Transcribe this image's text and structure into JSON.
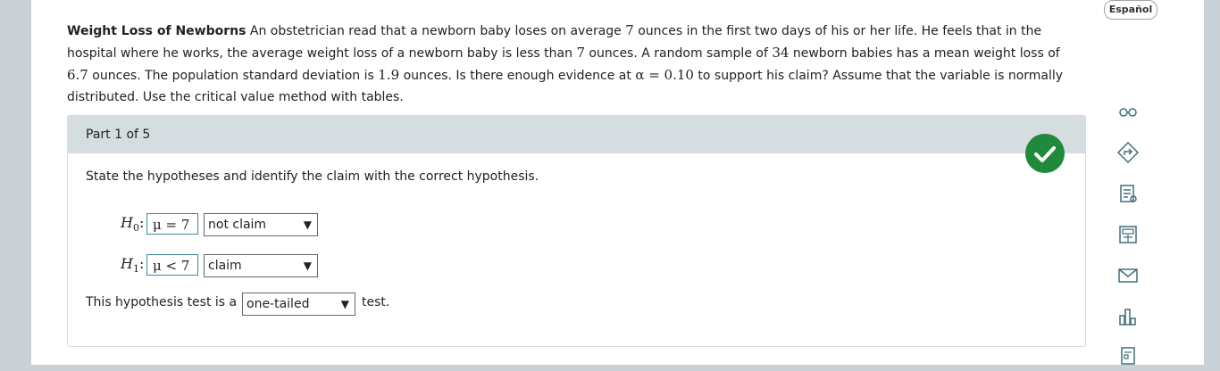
{
  "language_button": "Español",
  "problem": {
    "title": "Weight Loss of Newborns",
    "line1_a": " An obstetrician read that a newborn baby loses on average ",
    "n1": "7",
    "line1_b": " ounces in the first two days of his or her life. He feels that in the",
    "line2_a": "hospital where he works, the average weight loss of a newborn baby is less than ",
    "n2": "7",
    "line2_b": " ounces. A random sample of ",
    "n3": "34",
    "line2_c": " newborn babies has a mean weight loss of",
    "n4": "6.7",
    "line3_a": " ounces. The population standard deviation is ",
    "n5": "1.9",
    "line3_b": " ounces. Is there enough evidence at ",
    "alpha": "α = 0.10",
    "line3_c": " to support his claim? Assume that the variable is normally",
    "line4": "distributed. Use the critical value method with tables."
  },
  "part": {
    "label": "Part 1 of 5",
    "instruction": "State the hypotheses and identify the claim with the correct hypothesis.",
    "h0": {
      "symbol": "H",
      "sub": "0",
      "answer": "μ = 7",
      "selection": "not claim"
    },
    "h1": {
      "symbol": "H",
      "sub": "1",
      "answer": "μ < 7",
      "selection": "claim"
    },
    "test_prefix": "This hypothesis test is a",
    "test_selection": "one-tailed",
    "test_suffix": "test."
  },
  "colors": {
    "header_bg": "#d6dde1",
    "check_green": "#1f8a3b",
    "answer_border": "#3a8a9a",
    "icon_color": "#3f6f7a"
  },
  "tools": [
    "glasses-icon",
    "diamond-arrow-icon",
    "notes-icon",
    "calculator-icon",
    "mail-icon",
    "bar-chart-icon",
    "document-icon"
  ]
}
